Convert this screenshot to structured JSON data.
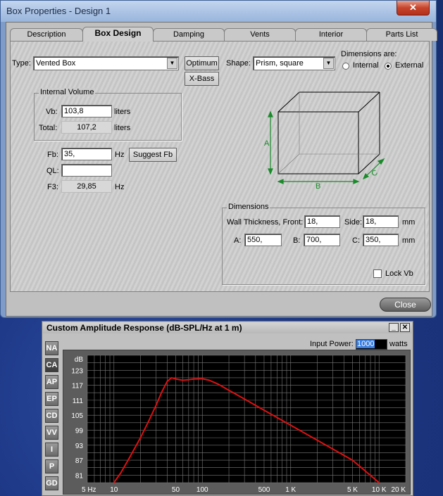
{
  "box_window": {
    "title": "Box Properties - Design 1",
    "close_x": "✕",
    "tabs": [
      "Description",
      "Box Design",
      "Damping",
      "Vents",
      "Interior",
      "Parts List"
    ],
    "active_tab": "Box Design",
    "type_label": "Type:",
    "type_value": "Vented Box",
    "optimum_button": "Optimum",
    "xbass_button": "X-Bass",
    "shape_label": "Shape:",
    "shape_value": "Prism, square",
    "dimensions_are_label": "Dimensions are:",
    "radio_internal": "Internal",
    "radio_external": "External",
    "radio_selected": "External",
    "internal_volume_title": "Internal Volume",
    "vb_label": "Vb:",
    "vb_value": "103,8",
    "vb_unit": "liters",
    "total_label": "Total:",
    "total_value": "107,2",
    "total_unit": "liters",
    "fb_label": "Fb:",
    "fb_value": "35,",
    "fb_unit": "Hz",
    "suggest_fb_button": "Suggest Fb",
    "ql_label": "QL:",
    "ql_value": "",
    "f3_label": "F3:",
    "f3_value": "29,85",
    "f3_unit": "Hz",
    "diagram_labels": {
      "a": "A",
      "b": "B",
      "c": "C"
    },
    "dimensions_title": "Dimensions",
    "wall_thickness_label": "Wall Thickness, Front:",
    "front_value": "18,",
    "side_label": "Side:",
    "side_value": "18,",
    "mm": "mm",
    "a_label": "A:",
    "a_value": "550,",
    "b_label": "B:",
    "b_value": "700,",
    "c_label": "C:",
    "c_value": "350,",
    "lock_vb_label": "Lock Vb",
    "lock_vb_checked": false,
    "close_button": "Close",
    "accent_green": "#1a8a2a"
  },
  "amp_window": {
    "title": "Custom Amplitude Response (dB-SPL/Hz at 1 m)",
    "minimize_label": "_",
    "close_label": "✕",
    "side_buttons": [
      "NA",
      "CA",
      "AP",
      "EP",
      "CD",
      "VV",
      "I",
      "P",
      "GD"
    ],
    "active_side_button": "CA",
    "input_power_label": "Input Power:",
    "input_power_value": "1000",
    "input_power_unit": "watts"
  },
  "chart_data": {
    "type": "line",
    "title": "Custom Amplitude Response (dB-SPL/Hz at 1 m)",
    "ylabel": "dB",
    "xlabel": "",
    "x_scale": "log",
    "xlim": [
      5,
      20000
    ],
    "ylim": [
      78,
      129
    ],
    "x_ticks": [
      5,
      10,
      50,
      100,
      500,
      1000,
      5000,
      10000,
      20000
    ],
    "x_tick_labels": [
      "5 Hz",
      "10",
      "50",
      "100",
      "500",
      "1 K",
      "5 K",
      "10 K",
      "20 K"
    ],
    "y_ticks": [
      81,
      87,
      93,
      99,
      105,
      111,
      117,
      123
    ],
    "grid": true,
    "background": "#000000",
    "series": [
      {
        "color": "#e01010",
        "x": [
          10,
          12,
          15,
          20,
          25,
          30,
          35,
          40,
          45,
          50,
          60,
          70,
          80,
          100,
          120,
          150,
          200,
          300,
          500,
          1000,
          2000,
          5000,
          10000
        ],
        "y": [
          78,
          82,
          88,
          96,
          103,
          109,
          114.5,
          118.5,
          120,
          119.5,
          119,
          119.2,
          119.5,
          119.6,
          119,
          117.5,
          115,
          111.5,
          107,
          101,
          95,
          87,
          78
        ]
      }
    ]
  }
}
